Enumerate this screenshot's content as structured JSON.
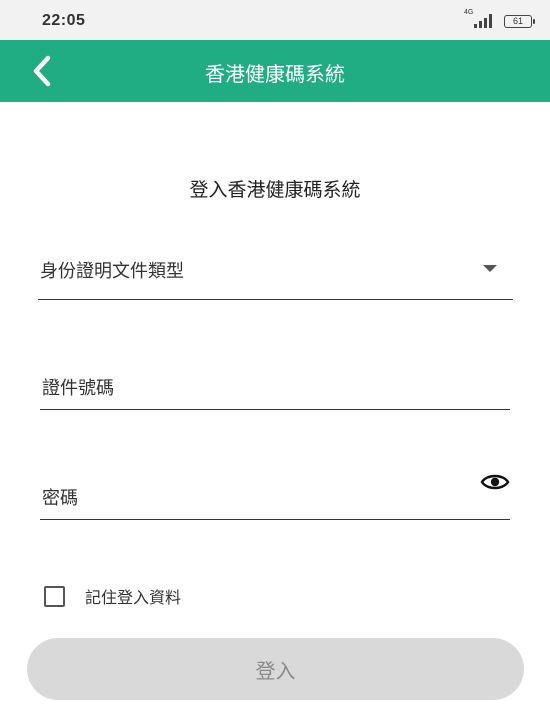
{
  "status_bar": {
    "time": "22:05",
    "network": "4G",
    "battery": "61",
    "icons": [
      "signal-icon",
      "battery-icon"
    ]
  },
  "app_bar": {
    "title": "香港健康碼系統",
    "back_icon": "chevron-left-icon",
    "color": "#21ad83"
  },
  "form": {
    "heading": "登入香港健康碼系統",
    "document_type_label": "身份證明文件類型",
    "document_type_icon": "dropdown-arrow-icon",
    "id_number_label": "證件號碼",
    "password_label": "密碼",
    "password_toggle_icon": "eye-icon",
    "remember_label": "記住登入資料",
    "remember_checked": false,
    "login_label": "登入"
  },
  "colors": {
    "accent": "#21ad83",
    "button_disabled": "#d9d9d9",
    "button_text_disabled": "#8a8a8a"
  }
}
